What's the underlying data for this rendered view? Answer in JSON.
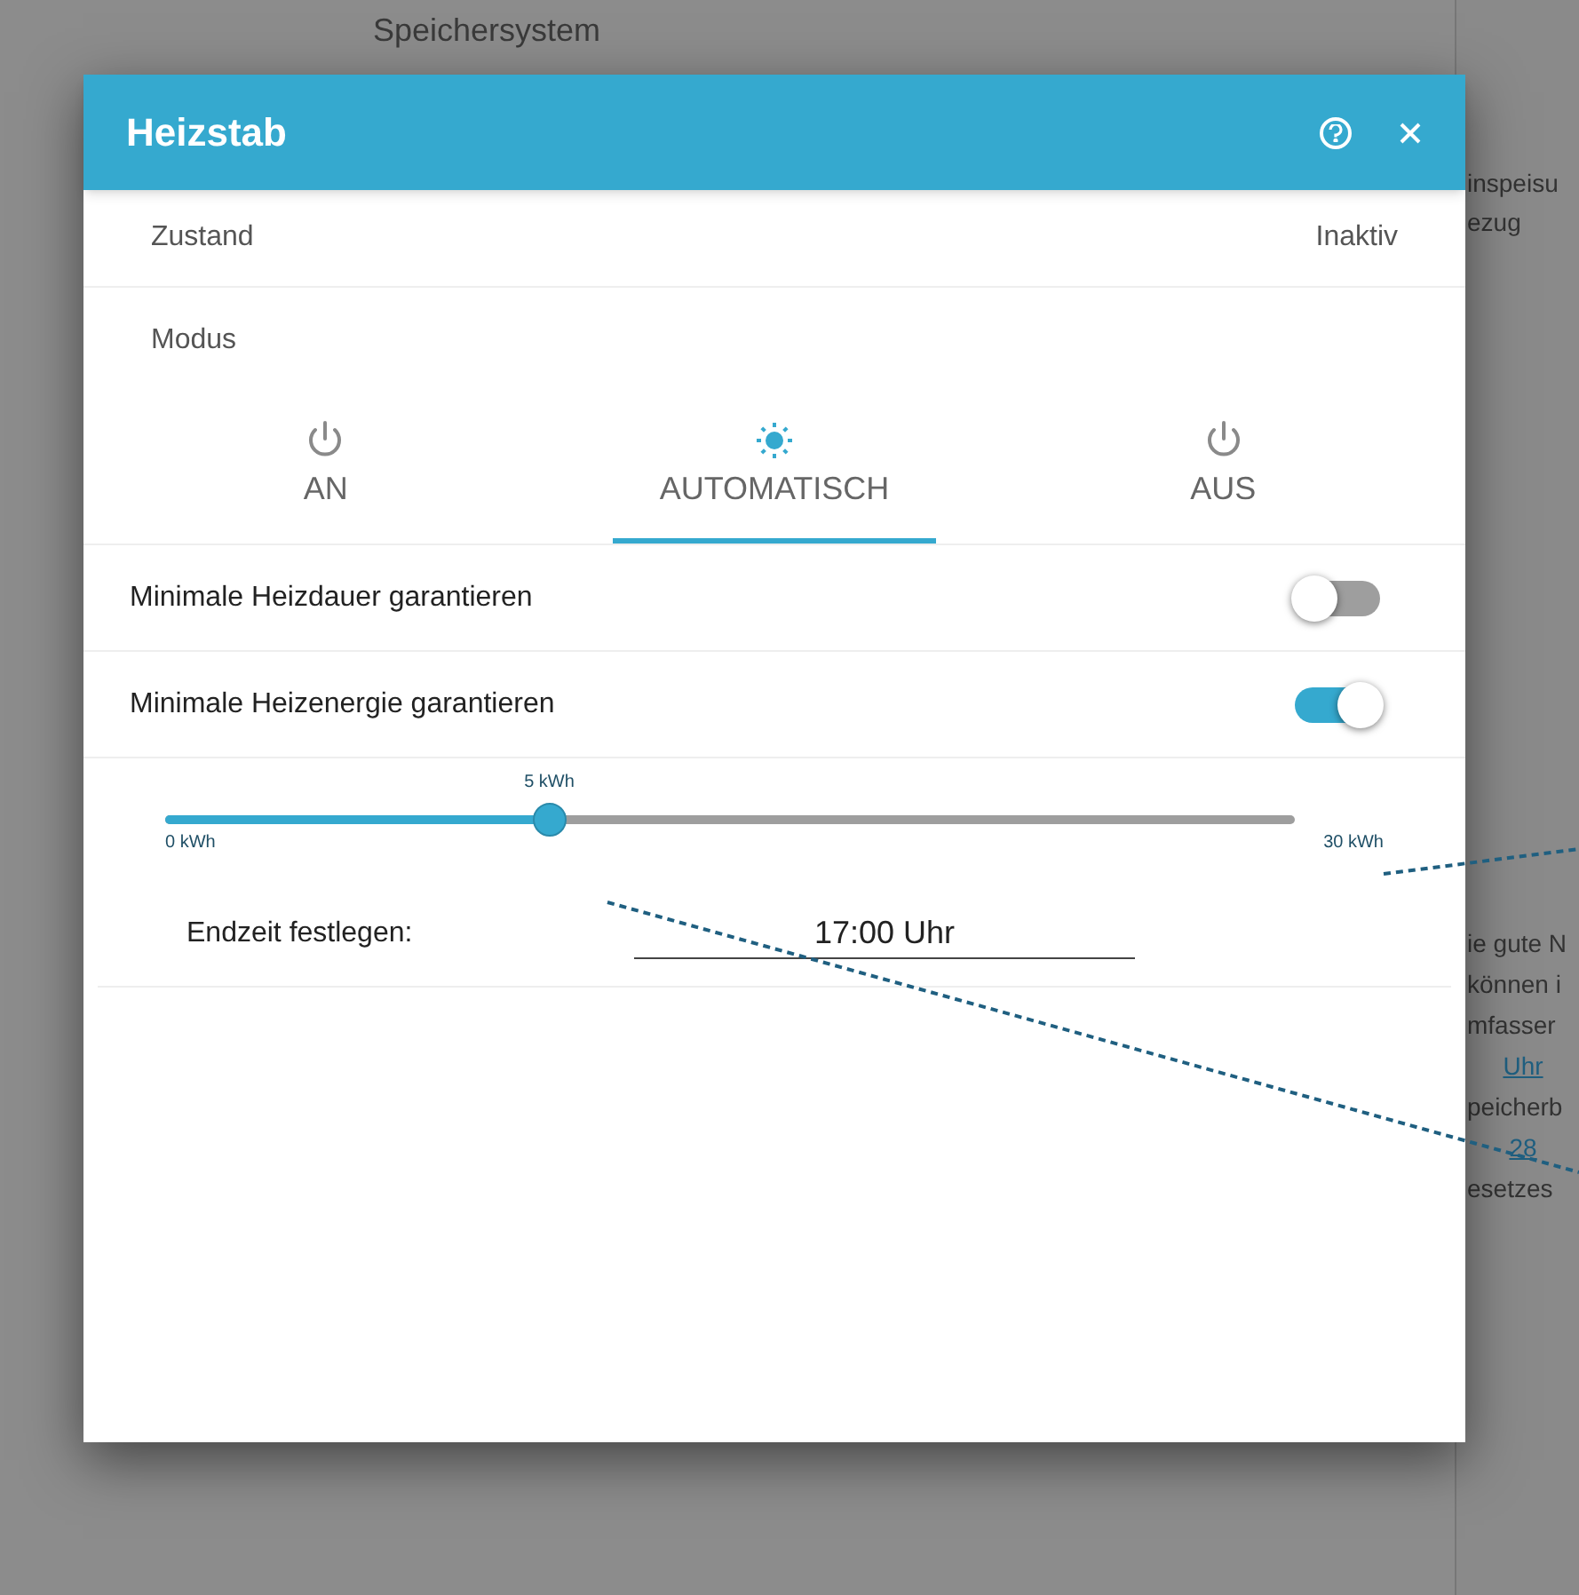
{
  "background": {
    "top_label": "Speichersystem",
    "side_texts": [
      "inspeisu",
      "ezug"
    ],
    "notice_lines": [
      {
        "text": "ie gute N",
        "kind": "text"
      },
      {
        "text": "können i",
        "kind": "text"
      },
      {
        "text": "mfasser",
        "kind": "text"
      },
      {
        "text": "Uhr",
        "kind": "link"
      },
      {
        "text": "peicherb",
        "kind": "text"
      },
      {
        "text": "28",
        "kind": "link"
      },
      {
        "text": "esetzes",
        "kind": "text"
      }
    ]
  },
  "dialog": {
    "title": "Heizstab",
    "status": {
      "label": "Zustand",
      "value": "Inaktiv"
    },
    "mode_label": "Modus",
    "modes": [
      {
        "label": "AN",
        "kind": "power",
        "selected": false
      },
      {
        "label": "AUTOMATISCH",
        "kind": "sun",
        "selected": true
      },
      {
        "label": "AUS",
        "kind": "power",
        "selected": false
      }
    ],
    "options": [
      {
        "label": "Minimale Heizdauer garantieren",
        "on": false
      },
      {
        "label": "Minimale Heizenergie garantieren",
        "on": true
      }
    ],
    "energy_slider": {
      "level": 0.34,
      "reading": "5 kWh",
      "min_label": "0 kWh",
      "max_label": "30 kWh"
    },
    "end_time": {
      "label": "Endzeit festlegen:",
      "value": "17:00 Uhr"
    }
  }
}
